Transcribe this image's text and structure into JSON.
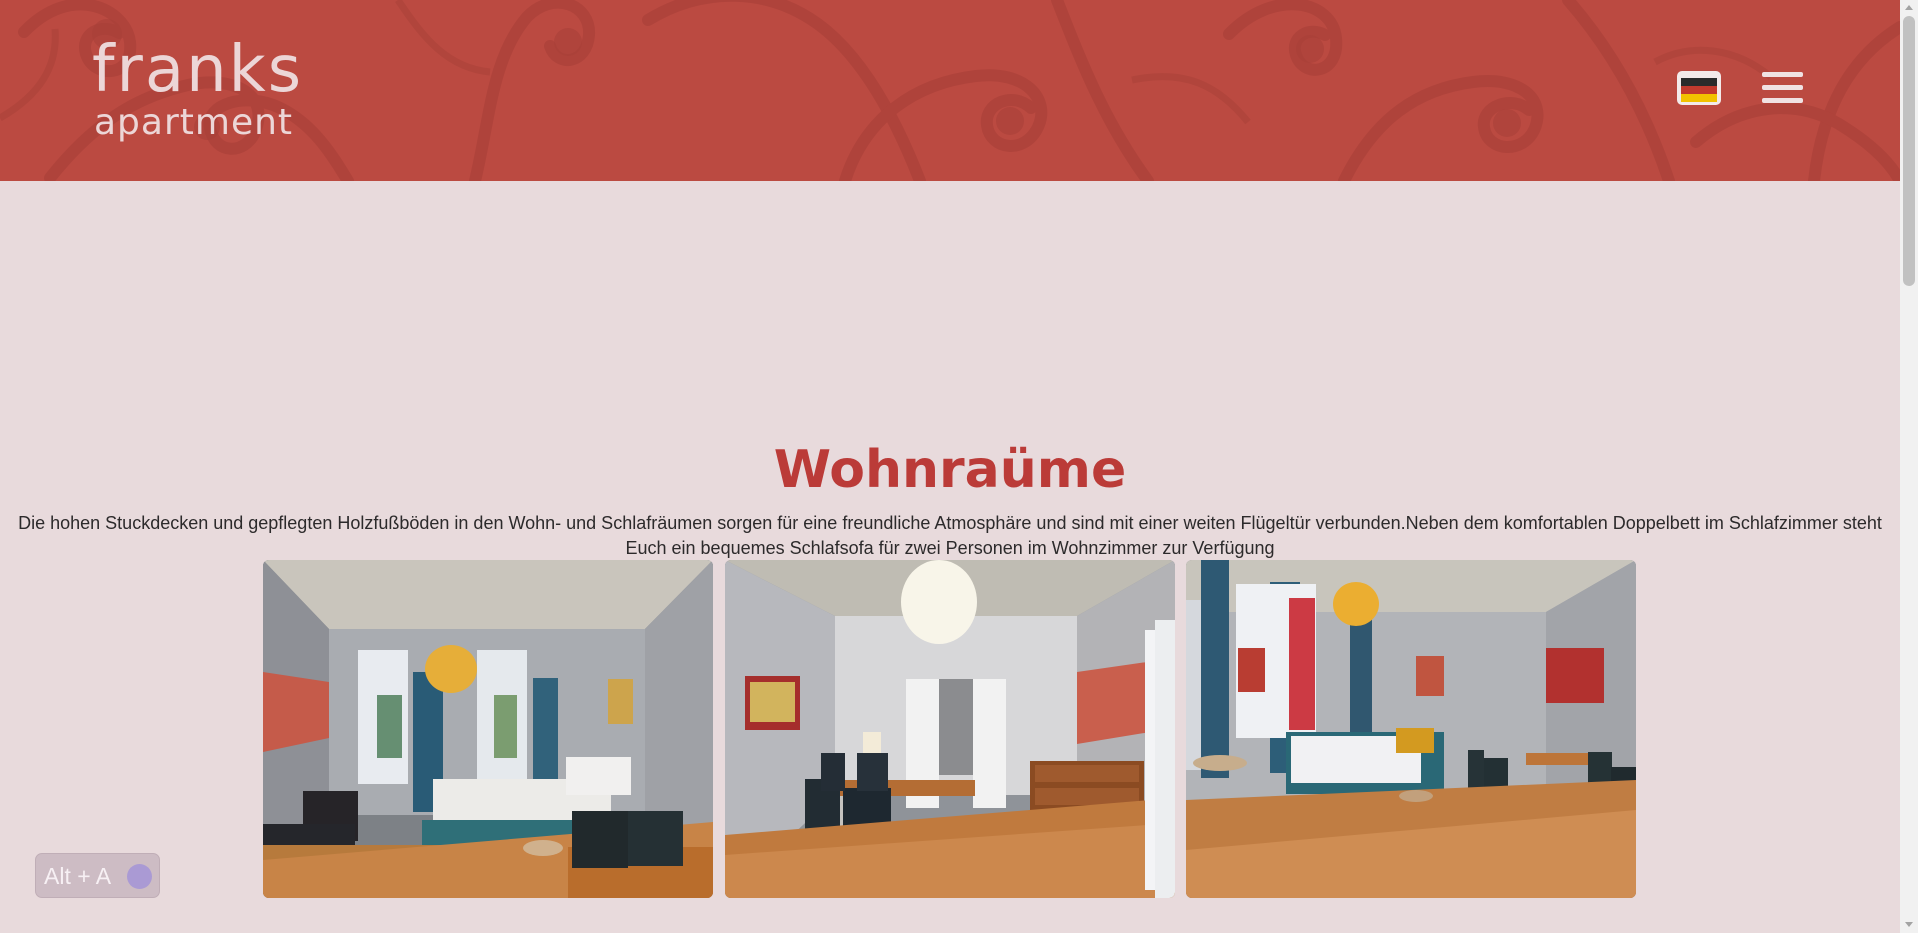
{
  "header": {
    "logo": {
      "line1": "franks",
      "line2": "apartment"
    },
    "language_flag_icon": "german-flag-icon",
    "menu_icon": "hamburger-menu-icon",
    "background_color": "#bb4a41"
  },
  "section": {
    "title": "Wohnraüme",
    "text": "Die hohen Stuckdecken und gepflegten Holzfußböden in den Wohn- und Schlafräumen sorgen für eine freundliche Atmosphäre und sind mit einer weiten Flügeltür verbunden.Neben dem komfortablen Doppelbett im Schlafzimmer steht Euch ein bequemes Schlafsofa für zwei Personen im Wohnzimmer zur Verfügung",
    "title_color": "#bb3b38"
  },
  "gallery": {
    "photos": [
      "bedroom-photo",
      "hallway-dining-photo",
      "living-room-photo"
    ]
  },
  "accessibility_widget": {
    "label": "Alt + A",
    "icon": "voice-accessibility-icon"
  },
  "colors": {
    "page_background": "#e8dadc",
    "accent": "#bb4a41"
  }
}
